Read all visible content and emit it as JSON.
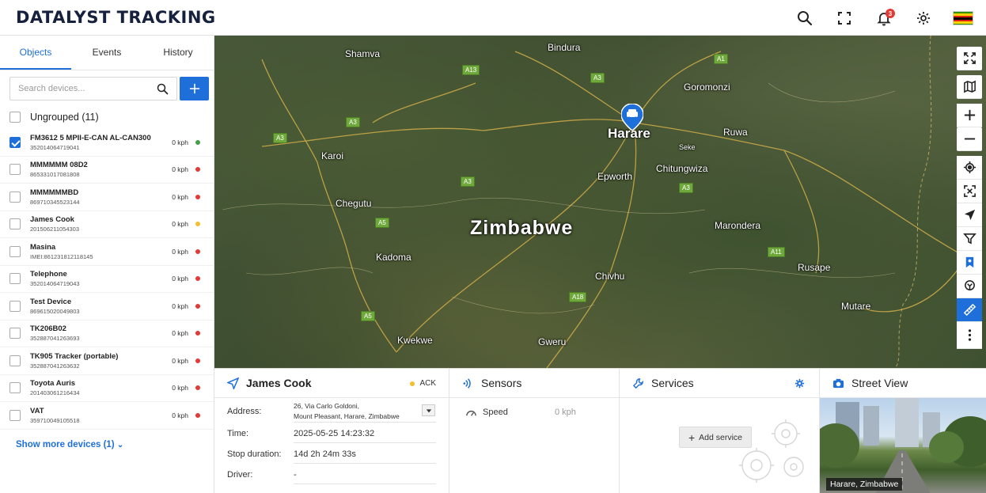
{
  "app": {
    "title": "DATALYST TRACKING",
    "notifications_count": "3"
  },
  "tabs": [
    {
      "label": "Objects"
    },
    {
      "label": "Events"
    },
    {
      "label": "History"
    }
  ],
  "search": {
    "placeholder": "Search devices..."
  },
  "group": {
    "label": "Ungrouped (11)"
  },
  "devices": [
    {
      "name": "FM3612 5 MPII-E-CAN AL-CAN300",
      "imei": "352014064719041",
      "speed": "0 kph",
      "status_color": "#43a047",
      "checked": true
    },
    {
      "name": "MMMMMM 08D2",
      "imei": "865331017081808",
      "speed": "0 kph",
      "status_color": "#e53935",
      "checked": false
    },
    {
      "name": "MMMMMMBD",
      "imei": "869710345523144",
      "speed": "0 kph",
      "status_color": "#e53935",
      "checked": false
    },
    {
      "name": "James Cook",
      "imei": "201506211054303",
      "speed": "0 kph",
      "status_color": "#f2c02e",
      "checked": false
    },
    {
      "name": "Masina",
      "imei": "IMEI:861231812118145",
      "speed": "0 kph",
      "status_color": "#e53935",
      "checked": false
    },
    {
      "name": "Telephone",
      "imei": "352014064719043",
      "speed": "0 kph",
      "status_color": "#e53935",
      "checked": false
    },
    {
      "name": "Test Device",
      "imei": "869615020049803",
      "speed": "0 kph",
      "status_color": "#e53935",
      "checked": false
    },
    {
      "name": "TK206B02",
      "imei": "352887041263693",
      "speed": "0 kph",
      "status_color": "#e53935",
      "checked": false
    },
    {
      "name": "TK905 Tracker (portable)",
      "imei": "352887041263632",
      "speed": "0 kph",
      "status_color": "#e53935",
      "checked": false
    },
    {
      "name": "Toyota Auris",
      "imei": "201403061216434",
      "speed": "0 kph",
      "status_color": "#e53935",
      "checked": false
    },
    {
      "name": "VAT",
      "imei": "359710049105518",
      "speed": "0 kph",
      "status_color": "#e53935",
      "checked": false
    }
  ],
  "show_more": {
    "label": "Show more devices (1)"
  },
  "map": {
    "country": "Zimbabwe",
    "cities": [
      {
        "name": "Shamva"
      },
      {
        "name": "Bindura"
      },
      {
        "name": "Goromonzi"
      },
      {
        "name": "Harare"
      },
      {
        "name": "Ruwa"
      },
      {
        "name": "Karoi"
      },
      {
        "name": "Epworth"
      },
      {
        "name": "Chitungwiza"
      },
      {
        "name": "Chegutu"
      },
      {
        "name": "Marondera"
      },
      {
        "name": "Kadoma"
      },
      {
        "name": "Rusape"
      },
      {
        "name": "Chivhu"
      },
      {
        "name": "Mutare"
      },
      {
        "name": "Kwekwe"
      },
      {
        "name": "Gweru"
      },
      {
        "name": "Seke"
      }
    ],
    "roads": [
      {
        "label": "A13"
      },
      {
        "label": "A1"
      },
      {
        "label": "A3"
      },
      {
        "label": "A3"
      },
      {
        "label": "A3"
      },
      {
        "label": "A3"
      },
      {
        "label": "A3"
      },
      {
        "label": "A5"
      },
      {
        "label": "A11"
      },
      {
        "label": "A18"
      },
      {
        "label": "A5"
      }
    ]
  },
  "object_panel": {
    "title": "James Cook",
    "ack": "ACK",
    "rows": [
      {
        "label": "Address:",
        "value_line1": "26, Via Carlo Goldoni,",
        "value_line2": "Mount Pleasant, Harare, Zimbabwe"
      },
      {
        "label": "Time:",
        "value": "2025-05-25 14:23:32"
      },
      {
        "label": "Stop duration:",
        "value": "14d 2h 24m 33s"
      },
      {
        "label": "Driver:",
        "value": "-"
      }
    ]
  },
  "sensors_panel": {
    "title": "Sensors",
    "speed_label": "Speed",
    "speed_value": "0 kph"
  },
  "services_panel": {
    "title": "Services",
    "add_label": "Add service"
  },
  "street_panel": {
    "title": "Street View",
    "location": "Harare, Zimbabwe"
  }
}
